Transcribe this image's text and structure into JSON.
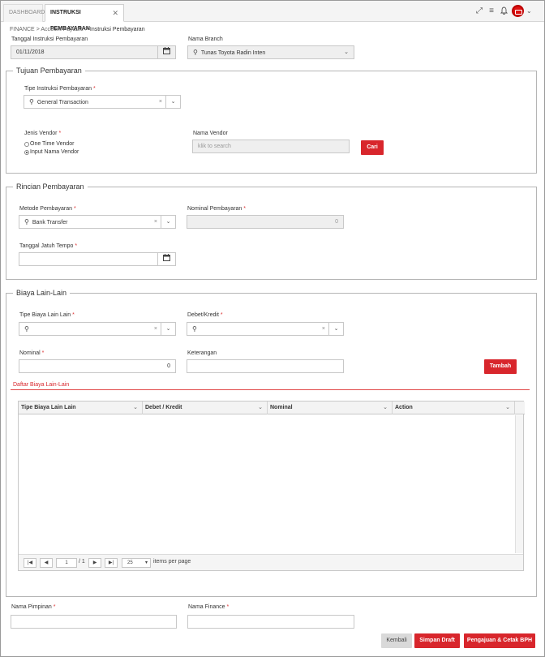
{
  "tabs": {
    "dashboard": "DASHBOARD",
    "active": "INSTRUKSI PEMBAYARAN",
    "close": "✕"
  },
  "breadcrumb": {
    "root": "FINANCE",
    "sep": ">",
    "mid": "Account Payable",
    "current": "Instruksi Pembayaran"
  },
  "header": {
    "tanggal_label": "Tanggal Instruksi Pembayaran",
    "tanggal_value": "01/11/2018",
    "branch_label": "Nama Branch",
    "branch_value": "Tunas Toyota Radin Inten"
  },
  "tujuan": {
    "legend": "Tujuan Pembayaran",
    "tipe_label": "Tipe Instruksi Pembayaran",
    "tipe_value": "General Transaction",
    "jenis_label": "Jenis Vendor",
    "radio_one_time": "One Time Vendor",
    "radio_input": "Input Nama Vendor",
    "nama_vendor_label": "Nama Vendor",
    "nama_vendor_placeholder": "klik to search",
    "cari_label": "Cari"
  },
  "rincian": {
    "legend": "Rincian Pembayaran",
    "metode_label": "Metode Pembayaran",
    "metode_value": "Bank Transfer",
    "nominal_label": "Nominal Pembayaran",
    "nominal_value": "0",
    "jatuh_tempo_label": "Tanggal Jatuh Tempo",
    "jatuh_tempo_value": ""
  },
  "biaya": {
    "legend": "Biaya Lain-Lain",
    "tipe_label": "Tipe Biaya Lain Lain",
    "debet_label": "Debet/Kredit",
    "nominal_label": "Nominal",
    "nominal_value": "0",
    "keterangan_label": "Keterangan",
    "tambah_label": "Tambah",
    "daftar_label": "Daftar Biaya Lain-Lain"
  },
  "grid": {
    "columns": [
      "Tipe Biaya Lain Lain",
      "Debet / Kredit",
      "Nominal",
      "Action"
    ],
    "page_value": "1",
    "page_of": "/ 1",
    "page_size": "25",
    "items_per_page": "items per page"
  },
  "footer": {
    "pimpinan_label": "Nama Pimpinan",
    "finance_label": "Nama Finance",
    "kembali": "Kembali",
    "simpan": "Simpan Draft",
    "pengajuan": "Pengajuan & Cetak BPH"
  },
  "required_mark": "*",
  "colors": {
    "accent": "#d8262c",
    "border": "#b5b5b5"
  },
  "icons": [
    "expand-icon",
    "menu-icon",
    "bell-icon",
    "user-icon",
    "calendar-icon",
    "search-icon",
    "chevron-down-icon"
  ]
}
